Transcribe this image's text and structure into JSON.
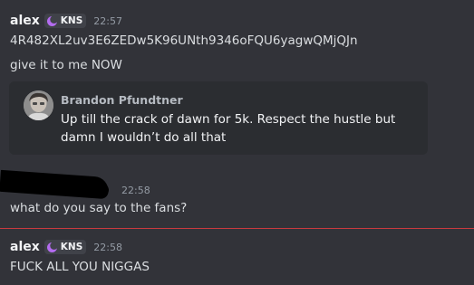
{
  "messages": [
    {
      "author": "alex",
      "tag": "KNS",
      "time": "22:57",
      "lines": [
        "4R482XL2uv3E6ZEDw5K96UNth9346oFQU6yagwQMjQJn",
        "give it to me NOW"
      ]
    },
    {
      "embed": {
        "author": "Brandon Pfundtner",
        "text": "Up till the crack of dawn for 5k. Respect the hustle but damn I wouldn’t do all that"
      }
    },
    {
      "time": "22:58",
      "lines": [
        "what do you say to the fans?"
      ]
    },
    {
      "author": "alex",
      "tag": "KNS",
      "time": "22:58",
      "lines": [
        "FUCK ALL YOU NIGGAS"
      ]
    }
  ],
  "icons": {
    "tag": "crescent-moon-icon",
    "avatar": "avatar-photo"
  },
  "colors": {
    "background": "#323339",
    "embed": "#2b2d31",
    "new_divider": "#c93a3f",
    "tag_icon": "#b46cf0"
  }
}
